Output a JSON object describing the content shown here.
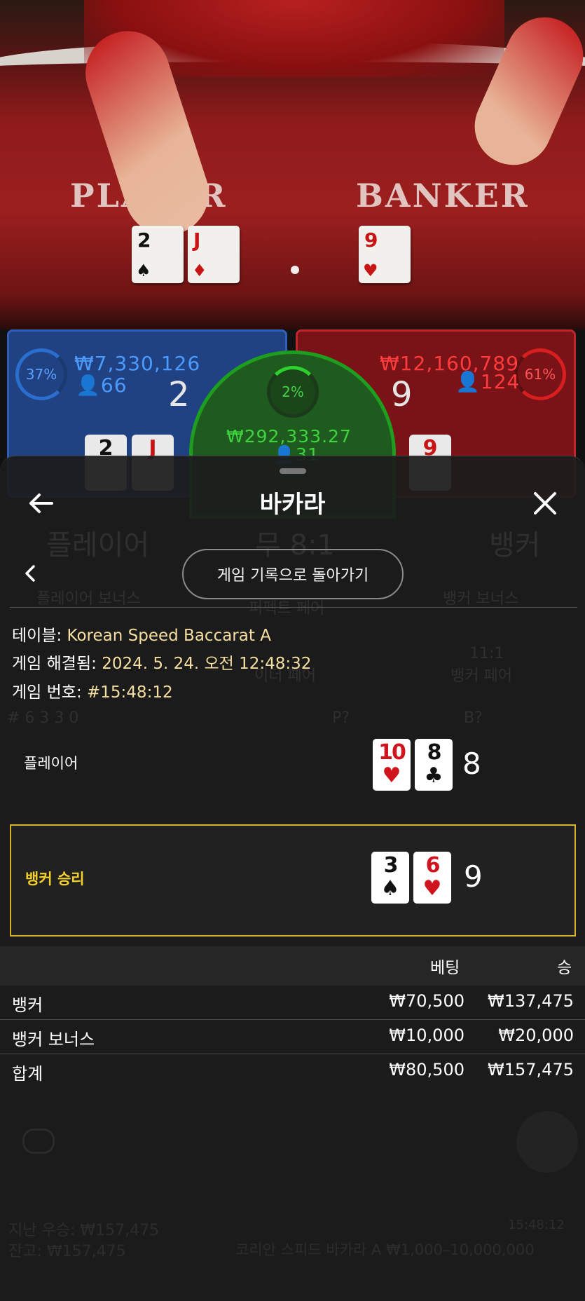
{
  "video": {
    "player_area": "PLAYER",
    "banker_area": "BANKER",
    "player_cards": [
      {
        "rank": "2",
        "suit": "♠",
        "red": false
      },
      {
        "rank": "J",
        "suit": "♦",
        "red": true
      }
    ],
    "banker_cards": [
      {
        "rank": "9",
        "suit": "♥",
        "red": true
      }
    ]
  },
  "bets": {
    "player": {
      "percent": "37%",
      "amount": "₩7,330,126",
      "players": "66",
      "score": "2"
    },
    "banker": {
      "percent": "61%",
      "amount": "₩12,160,789",
      "players": "124",
      "score": "9"
    },
    "tie": {
      "percent": "2%",
      "amount": "₩292,333.27",
      "players": "31"
    },
    "player_mini_cards": [
      {
        "rank": "2",
        "red": false
      },
      {
        "rank": "J",
        "red": true
      }
    ],
    "banker_mini_cards": [
      {
        "rank": "9",
        "red": true
      }
    ]
  },
  "background_ghost": {
    "player": "플레이어",
    "tie": "무 8:1",
    "banker": "뱅커",
    "player_bonus": "플레이어 보너스",
    "perfect_pair": "퍼펙트 페어",
    "banker_bonus": "뱅커 보너스",
    "either_pair": "이더 페어",
    "banker_pair_odds": "11:1",
    "banker_pair": "뱅커 페어",
    "counts": "# 6   3   3   0",
    "p_q": "P?",
    "b_q": "B?",
    "last_win": "지난 우승: ₩157,475",
    "balance": "잔고: ₩157,475",
    "table_limits": "코리안 스피드 바카라 A  ₩1,000–10,000,000",
    "clock": "15:48:12"
  },
  "sheet": {
    "title": "바카라",
    "return_button": "게임 기록으로 돌아가기",
    "info": {
      "table_label": "테이블:",
      "table_value": "Korean Speed Baccarat A",
      "resolved_label": "게임 해결됨:",
      "resolved_value": "2024. 5. 24. 오전 12:48:32",
      "game_no_label": "게임 번호:",
      "game_no_value": "#15:48:12"
    },
    "hands": {
      "player": {
        "label": "플레이어",
        "score": "8",
        "cards": [
          {
            "rank": "10",
            "suit": "♥",
            "red": true
          },
          {
            "rank": "8",
            "suit": "♣",
            "red": false
          }
        ]
      },
      "banker": {
        "label": "뱅커 승리",
        "score": "9",
        "cards": [
          {
            "rank": "3",
            "suit": "♠",
            "red": false
          },
          {
            "rank": "6",
            "suit": "♥",
            "red": true
          }
        ]
      }
    },
    "results": {
      "header_bet": "베팅",
      "header_win": "승",
      "rows": [
        {
          "name": "뱅커",
          "bet": "₩70,500",
          "win": "₩137,475"
        },
        {
          "name": "뱅커 보너스",
          "bet": "₩10,000",
          "win": "₩20,000"
        },
        {
          "name": "합계",
          "bet": "₩80,500",
          "win": "₩157,475"
        }
      ]
    }
  },
  "colors": {
    "accent_gold": "#d6b52a",
    "player_blue": "#4b9bff",
    "banker_red": "#ff3b3b",
    "tie_green": "#3fd33f"
  }
}
